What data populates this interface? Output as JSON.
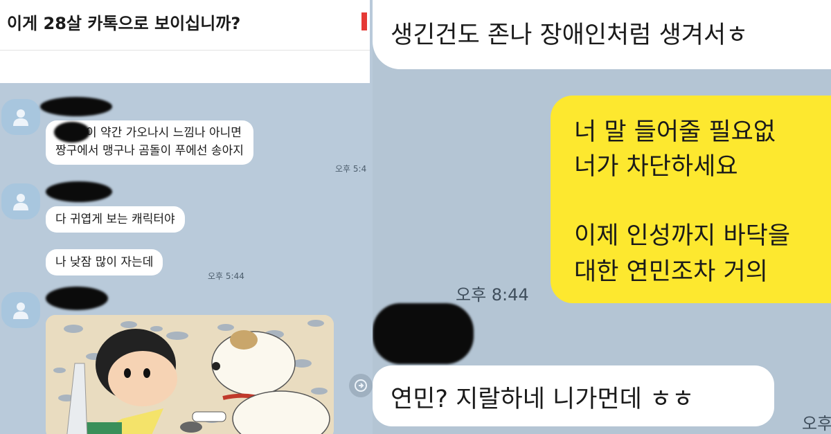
{
  "left": {
    "header_title": "이게 28살 카톡으로 보이십니까?",
    "messages": [
      {
        "lines": [
          "이 약간 가오나시 느낌나 아니면",
          "짱구에서 맹구나 곰돌이 푸에선 송아지"
        ],
        "time": "오후 5:4"
      },
      {
        "text": "다 귀엽게 보는 캐릭터야"
      },
      {
        "text": "나 낮잠 많이 자는데",
        "time": "오후 5:44"
      }
    ]
  },
  "right": {
    "top_text": "생긴건도 존나 장애인처럼 생겨서ㅎ",
    "yellow_lines": [
      "너 말 들어줄 필요없",
      "너가 차단하세요",
      "이제 인성까지 바닥을",
      "대한 연민조차 거의"
    ],
    "yellow_time": "오후 8:44",
    "reply_text": "연민? 지랄하네 니가먼데 ㅎㅎ",
    "reply_time": "오후"
  },
  "colors": {
    "chat_bg": "#b9cada",
    "my_bubble": "#fde82f",
    "their_bubble": "#ffffff"
  }
}
